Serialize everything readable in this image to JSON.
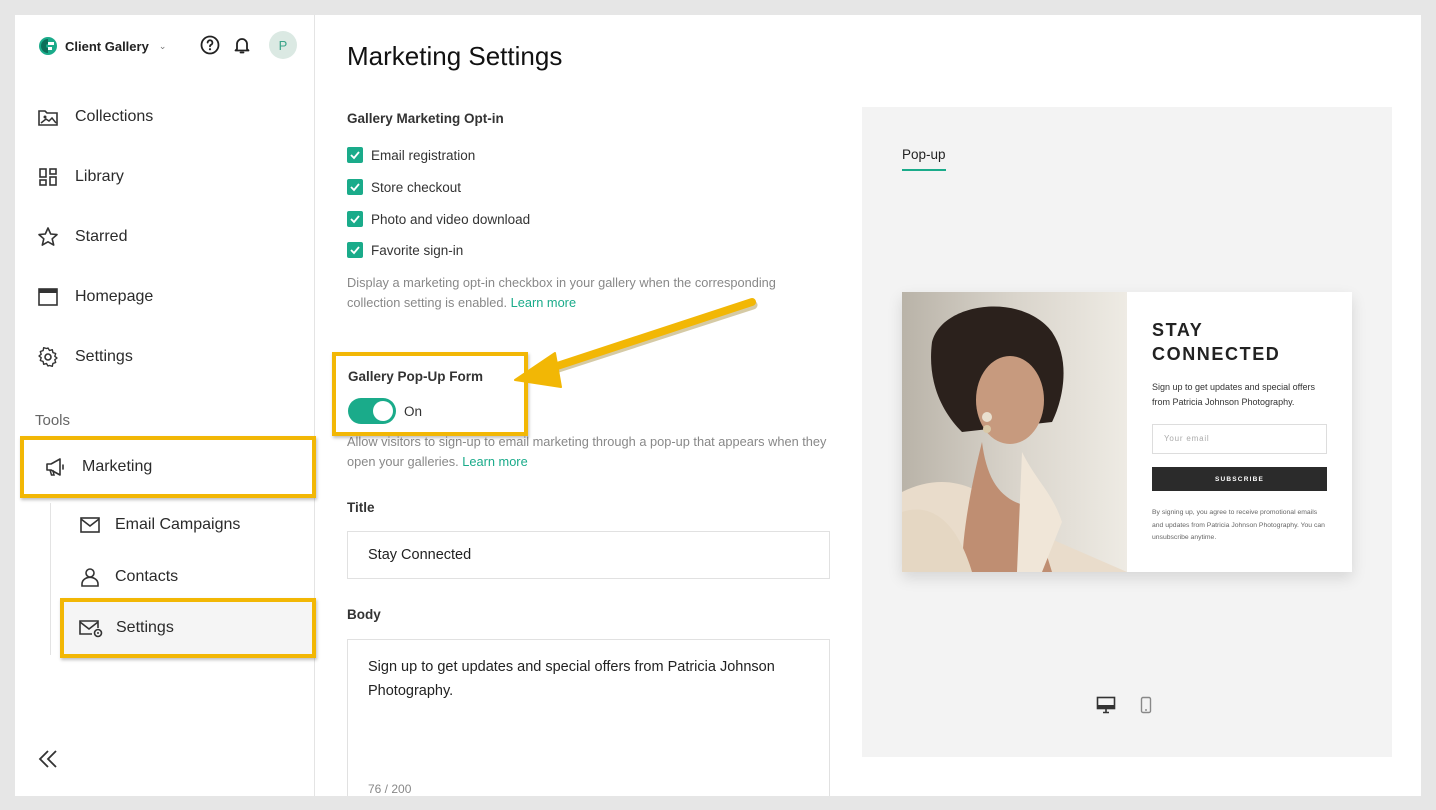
{
  "app": {
    "name": "Client Gallery",
    "avatar_initial": "P"
  },
  "sidebar": {
    "items": [
      {
        "label": "Collections",
        "icon": "image-folder-icon"
      },
      {
        "label": "Library",
        "icon": "grid-icon"
      },
      {
        "label": "Starred",
        "icon": "star-icon"
      },
      {
        "label": "Homepage",
        "icon": "browser-window-icon"
      },
      {
        "label": "Settings",
        "icon": "gear-icon"
      }
    ],
    "tools_label": "Tools",
    "marketing_label": "Marketing",
    "sub_items": [
      {
        "label": "Email Campaigns",
        "icon": "envelope-icon"
      },
      {
        "label": "Contacts",
        "icon": "person-icon"
      },
      {
        "label": "Settings",
        "icon": "envelope-gear-icon"
      }
    ]
  },
  "main": {
    "title": "Marketing Settings",
    "optin": {
      "label": "Gallery Marketing Opt-in",
      "options": [
        {
          "label": "Email registration",
          "checked": true
        },
        {
          "label": "Store checkout",
          "checked": true
        },
        {
          "label": "Photo and video download",
          "checked": true
        },
        {
          "label": "Favorite sign-in",
          "checked": true
        }
      ],
      "help": "Display a marketing opt-in checkbox in your gallery when the corresponding collection setting is enabled.",
      "learn_more": "Learn more"
    },
    "popup_form": {
      "label": "Gallery Pop-Up Form",
      "toggle_state": "On",
      "help": "Allow visitors to sign-up to email marketing through a pop-up that appears when they open your galleries.",
      "learn_more": "Learn more"
    },
    "title_field": {
      "label": "Title",
      "value": "Stay Connected"
    },
    "body_field": {
      "label": "Body",
      "value": "Sign up to get updates and special offers from Patricia Johnson Photography.",
      "counter": "76 / 200"
    }
  },
  "preview": {
    "tab": "Pop-up",
    "popup": {
      "title": "STAY CONNECTED",
      "body": "Sign up to get updates and special offers from Patricia Johnson Photography.",
      "email_placeholder": "Your email",
      "subscribe": "SUBSCRIBE",
      "fine_print": "By signing up, you agree to receive promotional emails and updates from Patricia Johnson Photography. You can unsubscribe anytime."
    },
    "devices": [
      "desktop-icon",
      "mobile-icon"
    ]
  },
  "colors": {
    "accent": "#1aab8a",
    "highlight": "#f2b705"
  }
}
